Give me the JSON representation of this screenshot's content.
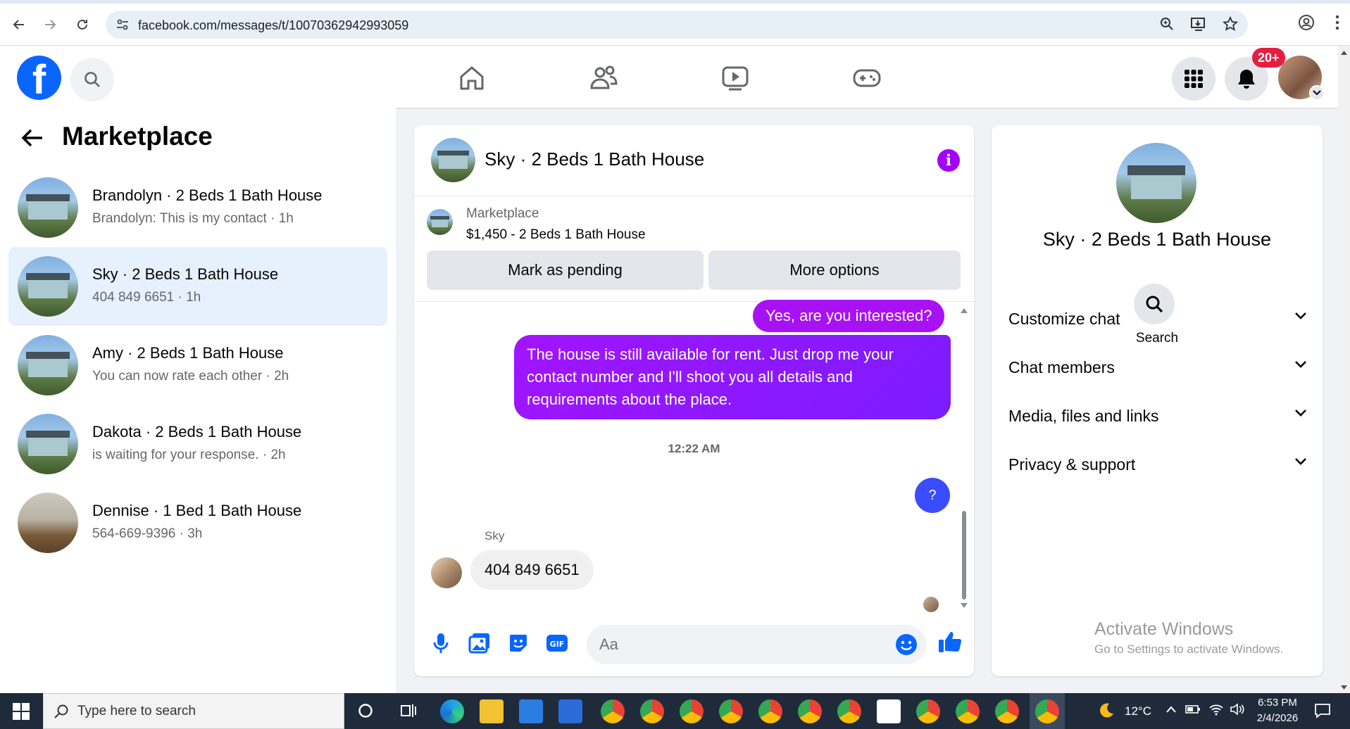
{
  "browser": {
    "url": "facebook.com/messages/t/10070362942993059"
  },
  "header": {
    "logo_letter": "f",
    "notifications_badge": "20+"
  },
  "marketplace": {
    "title": "Marketplace",
    "conversations": [
      {
        "name": "Brandolyn · 2 Beds 1 Bath House",
        "preview": "Brandolyn: This is my contact · 1h",
        "active": false
      },
      {
        "name": "Sky · 2 Beds 1 Bath House",
        "preview": "404 849 6651 · 1h",
        "active": true
      },
      {
        "name": "Amy · 2 Beds 1 Bath House",
        "preview": "You can now rate each other · 2h",
        "active": false
      },
      {
        "name": "Dakota · 2 Beds 1 Bath House",
        "preview": "is waiting for your response. · 2h",
        "active": false
      },
      {
        "name": "Dennise · 1 Bed 1 Bath House",
        "preview": "564-669-9396 · 3h",
        "active": false
      }
    ]
  },
  "chat": {
    "title": "Sky · 2 Beds 1 Bath House",
    "info_icon_label": "i",
    "listing_label": "Marketplace",
    "listing_desc": "$1,450 - 2 Beds 1 Bath House",
    "mark_pending": "Mark as pending",
    "more_options": "More options",
    "messages": {
      "out_1": "Yes, are you interested?",
      "out_2": "The house is still available for rent. Just drop me your contact number and I'll shoot you all details and requirements about the place.",
      "time": "12:22 AM",
      "question": "?",
      "sender": "Sky",
      "in_1": "404 849 6651"
    },
    "composer_placeholder": "Aa"
  },
  "details": {
    "title": "Sky · 2 Beds 1 Bath House",
    "search_label": "Search",
    "sections": [
      "Customize chat",
      "Chat members",
      "Media, files and links",
      "Privacy & support"
    ],
    "watermark_1": "Activate Windows",
    "watermark_2": "Go to Settings to activate Windows."
  },
  "taskbar": {
    "search_placeholder": "Type here to search",
    "temperature": "12°C",
    "time": "6:53 PM",
    "date": "2/4/2026"
  },
  "colors": {
    "fb_blue": "#0866ff",
    "messenger_purple": "#a200ff",
    "active_row": "#e7f0fd"
  }
}
